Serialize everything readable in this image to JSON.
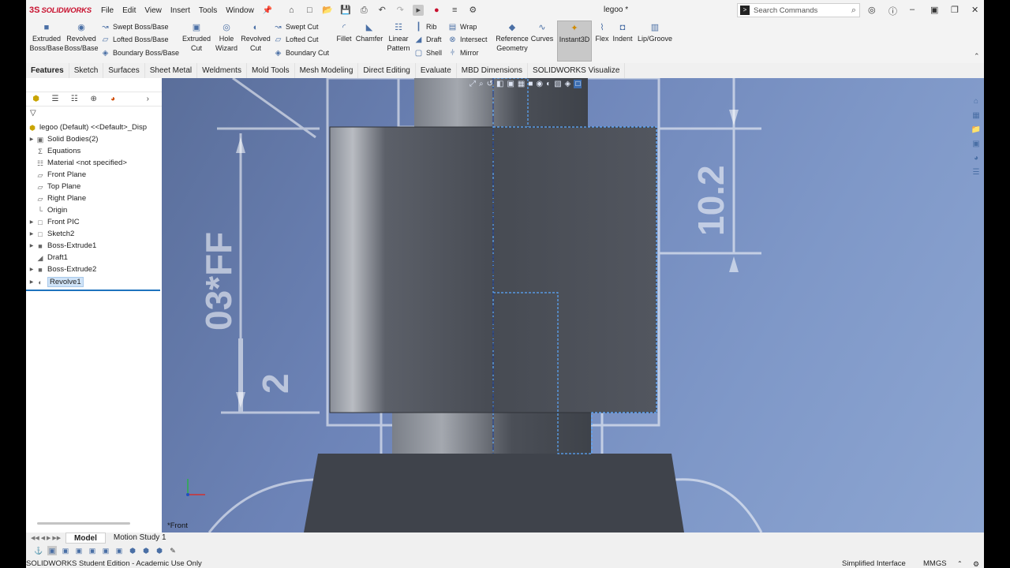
{
  "app": {
    "brand_ds": "3S",
    "brand": "SOLIDWORKS",
    "menus": [
      "File",
      "Edit",
      "View",
      "Insert",
      "Tools",
      "Window"
    ],
    "document_title": "legoo *",
    "search_placeholder": "Search Commands"
  },
  "toolbar": {
    "extruded_boss": "Extruded\nBoss/Base",
    "revolved_boss": "Revolved\nBoss/Base",
    "swept_boss": "Swept Boss/Base",
    "lofted_boss": "Lofted Boss/Base",
    "boundary_boss": "Boundary Boss/Base",
    "extruded_cut": "Extruded\nCut",
    "hole_wizard": "Hole\nWizard",
    "revolved_cut": "Revolved\nCut",
    "swept_cut": "Swept Cut",
    "lofted_cut": "Lofted Cut",
    "boundary_cut": "Boundary Cut",
    "fillet": "Fillet",
    "chamfer": "Chamfer",
    "linear_pattern": "Linear\nPattern",
    "rib": "Rib",
    "draft": "Draft",
    "shell": "Shell",
    "wrap": "Wrap",
    "intersect": "Intersect",
    "mirror": "Mirror",
    "reference_geometry": "Reference\nGeometry",
    "curves": "Curves",
    "instant3d": "Instant3D",
    "flex": "Flex",
    "indent": "Indent",
    "lip_groove": "Lip/Groove"
  },
  "tabs": [
    "Features",
    "Sketch",
    "Surfaces",
    "Sheet Metal",
    "Weldments",
    "Mold Tools",
    "Mesh Modeling",
    "Direct Editing",
    "Evaluate",
    "MBD Dimensions",
    "SOLIDWORKS Visualize"
  ],
  "tree": {
    "root": "legoo (Default) <<Default>_Disp",
    "items": [
      {
        "label": "Solid Bodies(2)",
        "expandable": true
      },
      {
        "label": "Equations",
        "expandable": false
      },
      {
        "label": "Material <not specified>",
        "expandable": false
      },
      {
        "label": "Front Plane",
        "expandable": false
      },
      {
        "label": "Top Plane",
        "expandable": false
      },
      {
        "label": "Right Plane",
        "expandable": false
      },
      {
        "label": "Origin",
        "expandable": false
      },
      {
        "label": "Front PIC",
        "expandable": true
      },
      {
        "label": "Sketch2",
        "expandable": true
      },
      {
        "label": "Boss-Extrude1",
        "expandable": true
      },
      {
        "label": "Draft1",
        "expandable": false
      },
      {
        "label": "Boss-Extrude2",
        "expandable": true
      },
      {
        "label": "Revolve1",
        "expandable": true
      }
    ]
  },
  "viewport": {
    "view_label": "*Front",
    "dim_vertical_big": "03*FF",
    "dim_right": "10.2",
    "dim_small": "2"
  },
  "bottom_tabs": [
    "Model",
    "Motion Study 1"
  ],
  "status": {
    "left": "SOLIDWORKS Student Edition - Academic Use Only",
    "interface": "Simplified Interface",
    "units": "MMGS"
  }
}
